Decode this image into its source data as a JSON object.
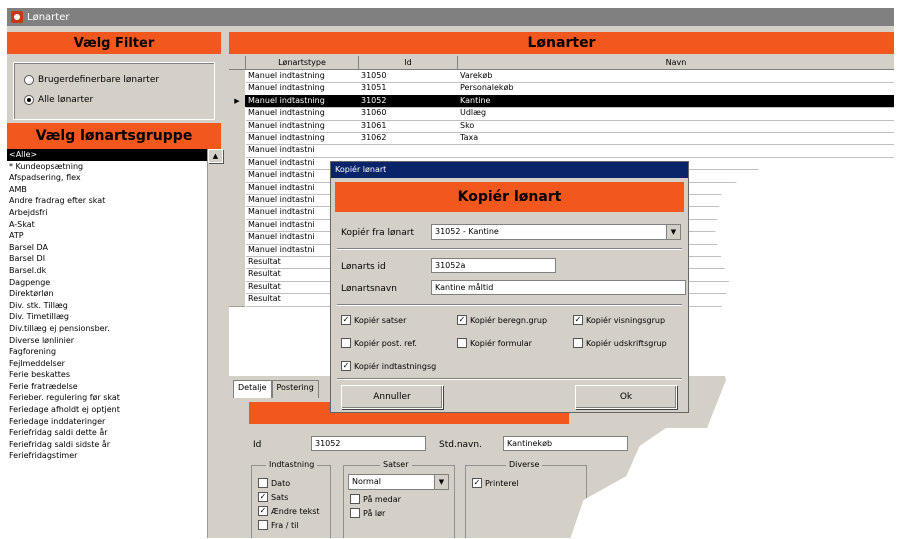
{
  "window": {
    "title": "Lønarter"
  },
  "left": {
    "filter_title": "Vælg Filter",
    "radios": [
      {
        "label": "Brugerdefinerbare lønarter",
        "checked": false
      },
      {
        "label": "Alle lønarter",
        "checked": true
      }
    ],
    "group_title": "Vælg lønartsgruppe",
    "groups": [
      "<Alle>",
      "* Kundeopsætning",
      "Afspadsering, flex",
      "AMB",
      "Andre fradrag efter skat",
      "Arbejdsfri",
      "A-Skat",
      "ATP",
      "Barsel DA",
      "Barsel DI",
      "Barsel.dk",
      "Dagpenge",
      "Direktørløn",
      "Div. stk. Tillæg",
      "Div. Timetillæg",
      "Div.tillæg ej pensionsber.",
      "Diverse lønlinier",
      "Fagforening",
      "Fejlmeddelser",
      "Ferie beskattes",
      "Ferie fratrædelse",
      "Ferieber. regulering før skat",
      "Feriedage afholdt ej optjent",
      "Feriedage inddateringer",
      "Feriefridag saldi dette år",
      "Feriefridag saldi sidste år",
      "Feriefridagstimer"
    ]
  },
  "right": {
    "title": "Lønarter",
    "columns": [
      "Lønartstype",
      "Id",
      "Navn"
    ],
    "rows": [
      {
        "type": "Manuel indtastning",
        "id": "31050",
        "name": "Varekøb",
        "selected": false
      },
      {
        "type": "Manuel indtastning",
        "id": "31051",
        "name": "Personalekøb",
        "selected": false
      },
      {
        "type": "Manuel indtastning",
        "id": "31052",
        "name": "Kantine",
        "selected": true
      },
      {
        "type": "Manuel indtastning",
        "id": "31060",
        "name": "Udlæg",
        "selected": false
      },
      {
        "type": "Manuel indtastning",
        "id": "31061",
        "name": "Sko",
        "selected": false
      },
      {
        "type": "Manuel indtastning",
        "id": "31062",
        "name": "Taxa",
        "selected": false
      },
      {
        "type": "Manuel indtastni",
        "id": "",
        "name": "",
        "selected": false
      },
      {
        "type": "Manuel indtastni",
        "id": "",
        "name": "",
        "selected": false
      },
      {
        "type": "Manuel indtastni",
        "id": "",
        "name": "",
        "selected": false
      },
      {
        "type": "Manuel indtastni",
        "id": "",
        "name": "",
        "selected": false
      },
      {
        "type": "Manuel indtastni",
        "id": "",
        "name": "",
        "selected": false
      },
      {
        "type": "Manuel indtastni",
        "id": "",
        "name": "",
        "selected": false
      },
      {
        "type": "Manuel indtastni",
        "id": "",
        "name": "",
        "selected": false
      },
      {
        "type": "Manuel indtastni",
        "id": "",
        "name": "",
        "selected": false
      },
      {
        "type": "Manuel indtastni",
        "id": "",
        "name": "",
        "selected": false
      },
      {
        "type": "Resultat",
        "id": "",
        "name": "",
        "selected": false
      },
      {
        "type": "Resultat",
        "id": "",
        "name": "",
        "selected": false
      },
      {
        "type": "Resultat",
        "id": "",
        "name": "",
        "selected": false
      },
      {
        "type": "Resultat",
        "id": "",
        "name": "",
        "selected": false
      }
    ],
    "tabs": [
      "Detalje",
      "Postering"
    ],
    "detail": {
      "id_label": "Id",
      "id_value": "31052",
      "stdnavn_label": "Std.navn.",
      "stdnavn_value": "Kantinekøb",
      "indtastning": {
        "title": "Indtastning",
        "items": [
          {
            "label": "Dato",
            "checked": false
          },
          {
            "label": "Sats",
            "checked": true
          },
          {
            "label": "Ændre tekst",
            "checked": true
          },
          {
            "label": "Fra / til",
            "checked": false
          }
        ]
      },
      "satser": {
        "title": "Satser",
        "select": "Normal",
        "items": [
          {
            "label": "På medar",
            "checked": false
          },
          {
            "label": "På lør",
            "checked": false
          }
        ]
      },
      "diverse": {
        "title": "Diverse",
        "items": [
          {
            "label": "Printerel",
            "checked": true
          }
        ]
      }
    }
  },
  "dialog": {
    "title": "Kopiér lønart",
    "heading": "Kopiér lønart",
    "from_label": "Kopiér fra lønart",
    "from_value": "31052 - Kantine",
    "id_label": "Lønarts id",
    "id_value": "31052a",
    "name_label": "Lønartsnavn",
    "name_value": "Kantine måltid",
    "checks": [
      {
        "label": "Kopiér satser",
        "checked": true
      },
      {
        "label": "Kopiér beregn.grup",
        "checked": true
      },
      {
        "label": "Kopiér visningsgrup",
        "checked": true
      },
      {
        "label": "Kopiér post. ref.",
        "checked": false
      },
      {
        "label": "Kopiér formular",
        "checked": false
      },
      {
        "label": "Kopiér udskriftsgrup",
        "checked": false
      },
      {
        "label": "Kopiér indtastningsg",
        "checked": true
      }
    ],
    "cancel_label": "Annuller",
    "ok_label": "Ok"
  }
}
